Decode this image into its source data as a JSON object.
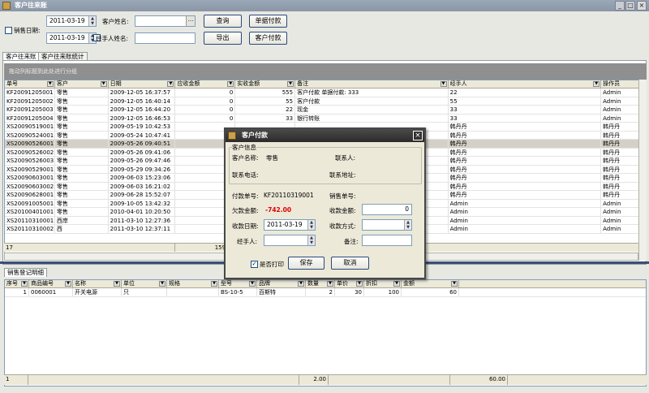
{
  "window": {
    "title": "客户往来账"
  },
  "filters": {
    "sales_date_label": "销售日期:",
    "date_from": "2011-03-19",
    "date_to": "2011-03-19",
    "customer_name_label": "客户姓名:",
    "customer_name_value": "",
    "handler_name_label": "经手人姓名:",
    "handler_name_value": "",
    "ellipsis": "..."
  },
  "buttons": {
    "query": "查询",
    "batch_pay": "单据付款",
    "export": "导出",
    "customer_pay": "客户付款"
  },
  "tabs": [
    "客户往来账",
    "客户往来账统计"
  ],
  "group_hint": "拖动列标题到此处进行分组",
  "main_table": {
    "columns": [
      "单号",
      "客户",
      "日期",
      "应收金额",
      "实收金额",
      "备注",
      "经手人",
      "操作员"
    ],
    "rows": [
      [
        "KF20091205001",
        "零售",
        "2009-12-05 16:37:57",
        "0",
        "555",
        "客户付款 单据付款:   333",
        "22",
        "Admin"
      ],
      [
        "KF20091205002",
        "零售",
        "2009-12-05 16:40:14",
        "0",
        "55",
        "客户付款",
        "55",
        "Admin"
      ],
      [
        "KF20091205003",
        "零售",
        "2009-12-05 16:44:20",
        "0",
        "22",
        "现金",
        "33",
        "Admin"
      ],
      [
        "KF20091205004",
        "零售",
        "2009-12-05 16:46:53",
        "0",
        "33",
        "银行转账",
        "33",
        "Admin"
      ],
      [
        "XS20090519001",
        "零售",
        "2009-05-19 10:42:53",
        "",
        "",
        "",
        "韩丹丹",
        "韩丹丹"
      ],
      [
        "XS20090524001",
        "零售",
        "2009-05-24 10:47:41",
        "",
        "",
        "",
        "韩丹丹",
        "韩丹丹"
      ],
      [
        "XS20090526001",
        "零售",
        "2009-05-26 09:40:51",
        "",
        "",
        "",
        "韩丹丹",
        "韩丹丹"
      ],
      [
        "XS20090526002",
        "零售",
        "2009-05-26 09:41:06",
        "",
        "",
        "",
        "韩丹丹",
        "韩丹丹"
      ],
      [
        "XS20090526003",
        "零售",
        "2009-05-26 09:47:46",
        "",
        "",
        "",
        "韩丹丹",
        "韩丹丹"
      ],
      [
        "XS20090529001",
        "零售",
        "2009-05-29 09:34:26",
        "",
        "",
        "",
        "韩丹丹",
        "韩丹丹"
      ],
      [
        "XS20090603001",
        "零售",
        "2009-06-03 15:23:06",
        "",
        "",
        "",
        "韩丹丹",
        "韩丹丹"
      ],
      [
        "XS20090603002",
        "零售",
        "2009-06-03 16:21:02",
        "",
        "",
        "",
        "韩丹丹",
        "韩丹丹"
      ],
      [
        "XS20090628001",
        "零售",
        "2009-06-28 15:52:07",
        "",
        "",
        "",
        "韩丹丹",
        "韩丹丹"
      ],
      [
        "XS20091005001",
        "零售",
        "2009-10-05 13:42:32",
        "",
        "",
        "",
        "Admin",
        "Admin"
      ],
      [
        "XS20100401001",
        "零售",
        "2010-04-01 10:20:50",
        "13",
        "",
        "",
        "Admin",
        "Admin"
      ],
      [
        "XS20110310001",
        "西岸",
        "2011-03-10 12:27:36",
        "",
        "",
        "",
        "Admin",
        "Admin"
      ],
      [
        "XS20110310002",
        "西",
        "2011-03-10 12:37:11",
        "",
        "",
        "",
        "Admin",
        "Admin"
      ]
    ],
    "selected_index": 6,
    "footer_count": "17",
    "footer_total": "15920"
  },
  "detail_tab": "销售登记明细",
  "detail_table": {
    "columns": [
      "序号",
      "商品编号",
      "名称",
      "单位",
      "规格",
      "型号",
      "品牌",
      "数量",
      "单价",
      "折扣",
      "金额"
    ],
    "rows": [
      [
        "1",
        "0060001",
        "开关电源",
        "只",
        "",
        "BS-10-5",
        "百斯特",
        "2",
        "30",
        "100",
        "60"
      ]
    ],
    "footer": {
      "count": "1",
      "qty": "2.00",
      "amount": "60.00"
    }
  },
  "dialog": {
    "title": "客户付款",
    "group_label": "客户信息",
    "customer_name_label": "客户名称:",
    "customer_name_value": "零售",
    "contact_label": "联系人:",
    "phone_label": "联系电话:",
    "address_label": "联系地址:",
    "pay_no_label": "付款单号:",
    "pay_no_value": "KF20110319001",
    "sales_no_label": "销售单号:",
    "owed_label": "欠款金额:",
    "owed_value": "-742.00",
    "received_amount_label": "收款金额:",
    "received_amount_value": "0",
    "received_date_label": "收款日期:",
    "received_date_value": "2011-03-19",
    "method_label": "收款方式:",
    "handler_label": "经手人:",
    "note_label": "备注:",
    "print_label": "是否打印",
    "save": "保存",
    "cancel": "取消"
  },
  "colors": {
    "accent": "#2a4a7a",
    "owed": "#e00000"
  }
}
